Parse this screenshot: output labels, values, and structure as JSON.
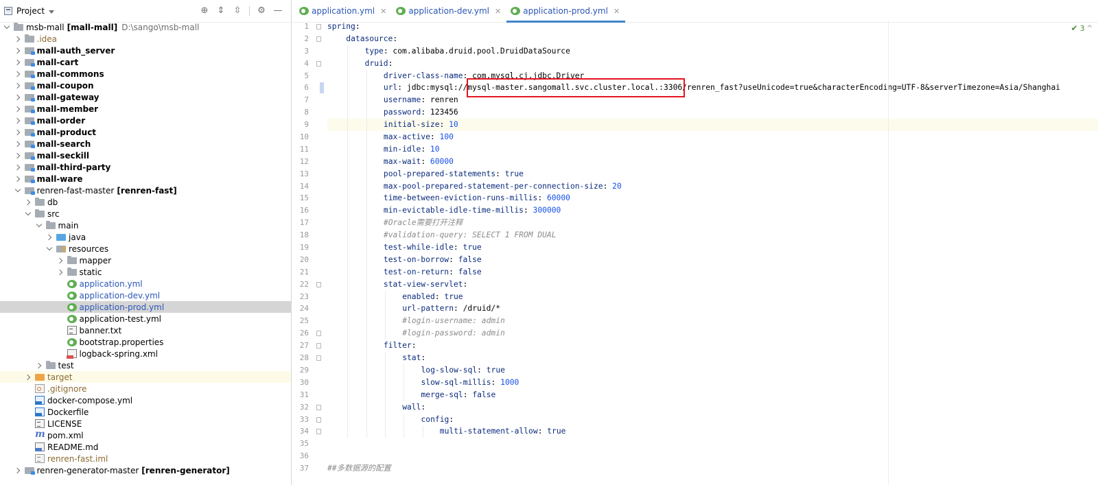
{
  "project_panel": {
    "title": "Project",
    "tree": [
      {
        "label": "msb-mall",
        "bold_part": "[mall-mall]",
        "path": "D:\\sango\\msb-mall",
        "depth": 0,
        "arrow": "down",
        "icon": "folder-icon"
      },
      {
        "label": ".idea",
        "depth": 1,
        "arrow": "right",
        "icon": "folder-icon",
        "style": "brown"
      },
      {
        "label": "mall-auth_server",
        "depth": 1,
        "arrow": "right",
        "icon": "module-icon",
        "style": "bold"
      },
      {
        "label": "mall-cart",
        "depth": 1,
        "arrow": "right",
        "icon": "module-icon",
        "style": "bold"
      },
      {
        "label": "mall-commons",
        "depth": 1,
        "arrow": "right",
        "icon": "module-icon",
        "style": "bold"
      },
      {
        "label": "mall-coupon",
        "depth": 1,
        "arrow": "right",
        "icon": "module-icon",
        "style": "bold"
      },
      {
        "label": "mall-gateway",
        "depth": 1,
        "arrow": "right",
        "icon": "module-icon",
        "style": "bold"
      },
      {
        "label": "mall-member",
        "depth": 1,
        "arrow": "right",
        "icon": "module-icon",
        "style": "bold"
      },
      {
        "label": "mall-order",
        "depth": 1,
        "arrow": "right",
        "icon": "module-icon",
        "style": "bold"
      },
      {
        "label": "mall-product",
        "depth": 1,
        "arrow": "right",
        "icon": "module-icon",
        "style": "bold"
      },
      {
        "label": "mall-search",
        "depth": 1,
        "arrow": "right",
        "icon": "module-icon",
        "style": "bold"
      },
      {
        "label": "mall-seckill",
        "depth": 1,
        "arrow": "right",
        "icon": "module-icon",
        "style": "bold"
      },
      {
        "label": "mall-third-party",
        "depth": 1,
        "arrow": "right",
        "icon": "module-icon",
        "style": "bold"
      },
      {
        "label": "mall-ware",
        "depth": 1,
        "arrow": "right",
        "icon": "module-icon",
        "style": "bold"
      },
      {
        "label": "renren-fast-master",
        "bold_part": "[renren-fast]",
        "depth": 1,
        "arrow": "down",
        "icon": "module-icon"
      },
      {
        "label": "db",
        "depth": 2,
        "arrow": "right",
        "icon": "folder-icon"
      },
      {
        "label": "src",
        "depth": 2,
        "arrow": "down",
        "icon": "folder-icon"
      },
      {
        "label": "main",
        "depth": 3,
        "arrow": "down",
        "icon": "folder-icon"
      },
      {
        "label": "java",
        "depth": 4,
        "arrow": "right",
        "icon": "source-folder-icon"
      },
      {
        "label": "resources",
        "depth": 4,
        "arrow": "down",
        "icon": "resources-folder-icon"
      },
      {
        "label": "mapper",
        "depth": 5,
        "arrow": "right",
        "icon": "folder-icon"
      },
      {
        "label": "static",
        "depth": 5,
        "arrow": "right",
        "icon": "folder-icon"
      },
      {
        "label": "application.yml",
        "depth": 5,
        "arrow": "none",
        "icon": "yml-icon",
        "style": "blue"
      },
      {
        "label": "application-dev.yml",
        "depth": 5,
        "arrow": "none",
        "icon": "yml-icon",
        "style": "blue"
      },
      {
        "label": "application-prod.yml",
        "depth": 5,
        "arrow": "none",
        "icon": "yml-icon",
        "style": "blue",
        "selected": true
      },
      {
        "label": "application-test.yml",
        "depth": 5,
        "arrow": "none",
        "icon": "yml-icon"
      },
      {
        "label": "banner.txt",
        "depth": 5,
        "arrow": "none",
        "icon": "txt-icon"
      },
      {
        "label": "bootstrap.properties",
        "depth": 5,
        "arrow": "none",
        "icon": "yml-icon"
      },
      {
        "label": "logback-spring.xml",
        "depth": 5,
        "arrow": "none",
        "icon": "xml-icon"
      },
      {
        "label": "test",
        "depth": 3,
        "arrow": "right",
        "icon": "folder-icon"
      },
      {
        "label": "target",
        "depth": 2,
        "arrow": "right",
        "icon": "excluded-folder-icon",
        "style": "brown",
        "highlight": true
      },
      {
        "label": ".gitignore",
        "depth": 2,
        "arrow": "none",
        "icon": "git-icon",
        "style": "brown"
      },
      {
        "label": "docker-compose.yml",
        "depth": 2,
        "arrow": "none",
        "icon": "docker-icon"
      },
      {
        "label": "Dockerfile",
        "depth": 2,
        "arrow": "none",
        "icon": "docker-icon"
      },
      {
        "label": "LICENSE",
        "depth": 2,
        "arrow": "none",
        "icon": "txt-icon"
      },
      {
        "label": "pom.xml",
        "depth": 2,
        "arrow": "none",
        "icon": "maven-icon"
      },
      {
        "label": "README.md",
        "depth": 2,
        "arrow": "none",
        "icon": "md-icon"
      },
      {
        "label": "renren-fast.iml",
        "depth": 2,
        "arrow": "none",
        "icon": "iml-icon",
        "style": "brown"
      },
      {
        "label": "renren-generator-master",
        "bold_part": "[renren-generator]",
        "depth": 1,
        "arrow": "right",
        "icon": "module-icon"
      }
    ]
  },
  "tabs": [
    {
      "label": "application.yml",
      "active": false
    },
    {
      "label": "application-dev.yml",
      "active": false
    },
    {
      "label": "application-prod.yml",
      "active": true
    }
  ],
  "inspection": {
    "count": "3"
  },
  "editor": {
    "current_line": 9,
    "lines": [
      {
        "n": "1",
        "indent": 0,
        "key": "spring",
        "value": ""
      },
      {
        "n": "2",
        "indent": 1,
        "key": "datasource",
        "value": ""
      },
      {
        "n": "3",
        "indent": 2,
        "key": "type",
        "value": "com.alibaba.druid.pool.DruidDataSource"
      },
      {
        "n": "4",
        "indent": 2,
        "key": "druid",
        "value": ""
      },
      {
        "n": "5",
        "indent": 3,
        "key": "driver-class-name",
        "value": "com.mysql.cj.jdbc.Driver"
      },
      {
        "n": "6",
        "indent": 3,
        "key": "url",
        "value": "jdbc:mysql://mysql-master.sangomall.svc.cluster.local.:3306/renren_fast?useUnicode=true&characterEncoding=UTF-8&serverTimezone=Asia/Shanghai"
      },
      {
        "n": "7",
        "indent": 3,
        "key": "username",
        "value": "renren"
      },
      {
        "n": "8",
        "indent": 3,
        "key": "password",
        "value": "123456"
      },
      {
        "n": "9",
        "indent": 3,
        "key": "initial-size",
        "value": "10",
        "vtype": "num"
      },
      {
        "n": "10",
        "indent": 3,
        "key": "max-active",
        "value": "100",
        "vtype": "num"
      },
      {
        "n": "11",
        "indent": 3,
        "key": "min-idle",
        "value": "10",
        "vtype": "num"
      },
      {
        "n": "12",
        "indent": 3,
        "key": "max-wait",
        "value": "60000",
        "vtype": "num"
      },
      {
        "n": "13",
        "indent": 3,
        "key": "pool-prepared-statements",
        "value": "true",
        "vtype": "bool"
      },
      {
        "n": "14",
        "indent": 3,
        "key": "max-pool-prepared-statement-per-connection-size",
        "value": "20",
        "vtype": "num"
      },
      {
        "n": "15",
        "indent": 3,
        "key": "time-between-eviction-runs-millis",
        "value": "60000",
        "vtype": "num"
      },
      {
        "n": "16",
        "indent": 3,
        "key": "min-evictable-idle-time-millis",
        "value": "300000",
        "vtype": "num"
      },
      {
        "n": "17",
        "indent": 3,
        "comment": "#Oracle需要打开注释"
      },
      {
        "n": "18",
        "indent": 3,
        "comment": "#validation-query: SELECT 1 FROM DUAL"
      },
      {
        "n": "19",
        "indent": 3,
        "key": "test-while-idle",
        "value": "true",
        "vtype": "bool"
      },
      {
        "n": "20",
        "indent": 3,
        "key": "test-on-borrow",
        "value": "false",
        "vtype": "bool"
      },
      {
        "n": "21",
        "indent": 3,
        "key": "test-on-return",
        "value": "false",
        "vtype": "bool"
      },
      {
        "n": "22",
        "indent": 3,
        "key": "stat-view-servlet",
        "value": ""
      },
      {
        "n": "23",
        "indent": 4,
        "key": "enabled",
        "value": "true",
        "vtype": "bool"
      },
      {
        "n": "24",
        "indent": 4,
        "key": "url-pattern",
        "value": "/druid/*"
      },
      {
        "n": "25",
        "indent": 4,
        "comment": "#login-username: admin"
      },
      {
        "n": "26",
        "indent": 4,
        "comment": "#login-password: admin"
      },
      {
        "n": "27",
        "indent": 3,
        "key": "filter",
        "value": ""
      },
      {
        "n": "28",
        "indent": 4,
        "key": "stat",
        "value": ""
      },
      {
        "n": "29",
        "indent": 5,
        "key": "log-slow-sql",
        "value": "true",
        "vtype": "bool"
      },
      {
        "n": "30",
        "indent": 5,
        "key": "slow-sql-millis",
        "value": "1000",
        "vtype": "num"
      },
      {
        "n": "31",
        "indent": 5,
        "key": "merge-sql",
        "value": "false",
        "vtype": "bool"
      },
      {
        "n": "32",
        "indent": 4,
        "key": "wall",
        "value": ""
      },
      {
        "n": "33",
        "indent": 5,
        "key": "config",
        "value": ""
      },
      {
        "n": "34",
        "indent": 6,
        "key": "multi-statement-allow",
        "value": "true",
        "vtype": "bool"
      },
      {
        "n": "35",
        "indent": 0,
        "blank": true
      },
      {
        "n": "36",
        "indent": 0,
        "blank": true
      },
      {
        "n": "37",
        "indent": 0,
        "comment": "##多数据源的配置"
      }
    ]
  },
  "colors": {
    "accent": "#4083c9",
    "highlight_box": "#e5131f",
    "key": "#0b2b7d",
    "number": "#1750eb",
    "comment": "#8c8c8c"
  }
}
